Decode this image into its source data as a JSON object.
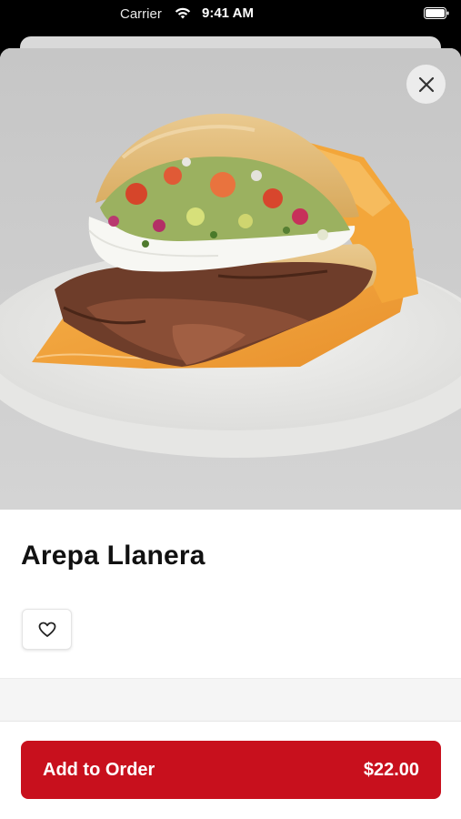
{
  "status_bar": {
    "carrier": "Carrier",
    "time": "9:41 AM"
  },
  "product": {
    "name": "Arepa Llanera"
  },
  "footer": {
    "add_label": "Add to Order",
    "price": "$22.00"
  },
  "colors": {
    "accent": "#c8101d"
  },
  "icons": {
    "close": "close-icon",
    "favorite": "heart-icon"
  }
}
